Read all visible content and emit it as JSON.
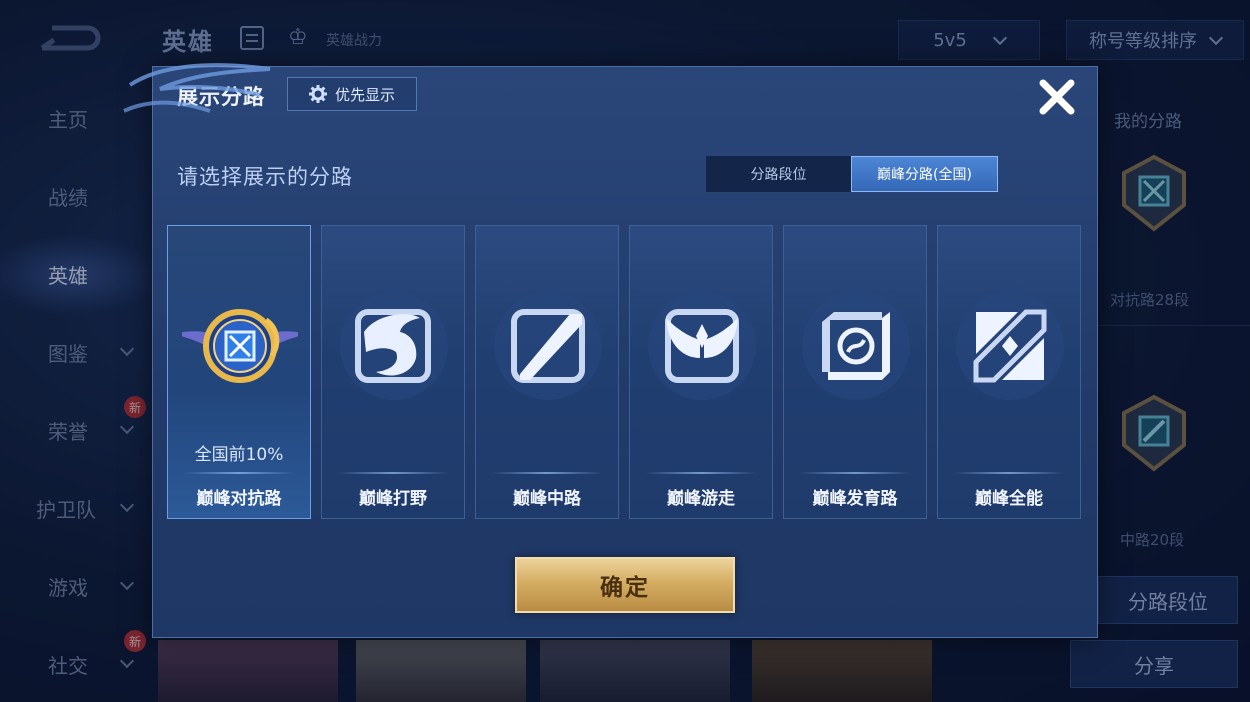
{
  "header": {
    "title": "英雄",
    "power_label": "英雄战力",
    "mode": "5v5",
    "sort": "称号等级排序"
  },
  "sidebar": {
    "items": [
      {
        "label": "主页",
        "active": false
      },
      {
        "label": "战绩",
        "active": false
      },
      {
        "label": "英雄",
        "active": true
      },
      {
        "label": "图鉴",
        "active": false
      },
      {
        "label": "荣誉",
        "active": false,
        "badge": "新"
      },
      {
        "label": "护卫队",
        "active": false
      },
      {
        "label": "游戏",
        "active": false
      },
      {
        "label": "社交",
        "active": false,
        "badge": "新"
      }
    ]
  },
  "right_panel": {
    "title": "我的分路",
    "lanes": [
      {
        "rank": "对抗路28段"
      },
      {
        "rank": "中路20段"
      }
    ],
    "lane_rank_button": "分路段位",
    "share_button": "分享"
  },
  "modal": {
    "title": "展示分路",
    "priority_button": "优先显示",
    "subtitle": "请选择展示的分路",
    "tabs": [
      {
        "label": "分路段位",
        "active": false
      },
      {
        "label": "巅峰分路(全国)",
        "active": true
      }
    ],
    "cards": [
      {
        "label": "巅峰对抗路",
        "sublabel": "全国前10%",
        "selected": true,
        "icon": "clash-lane-icon"
      },
      {
        "label": "巅峰打野",
        "sublabel": "",
        "selected": false,
        "icon": "jungle-dragon-icon"
      },
      {
        "label": "巅峰中路",
        "sublabel": "",
        "selected": false,
        "icon": "mid-lane-icon"
      },
      {
        "label": "巅峰游走",
        "sublabel": "",
        "selected": false,
        "icon": "roam-wings-icon"
      },
      {
        "label": "巅峰发育路",
        "sublabel": "",
        "selected": false,
        "icon": "farm-lane-icon"
      },
      {
        "label": "巅峰全能",
        "sublabel": "",
        "selected": false,
        "icon": "all-round-icon"
      }
    ],
    "confirm_button": "确定"
  },
  "colors": {
    "accent": "#3468b7",
    "gold": "#d4ad63",
    "modal_bg": "#2a4679"
  }
}
